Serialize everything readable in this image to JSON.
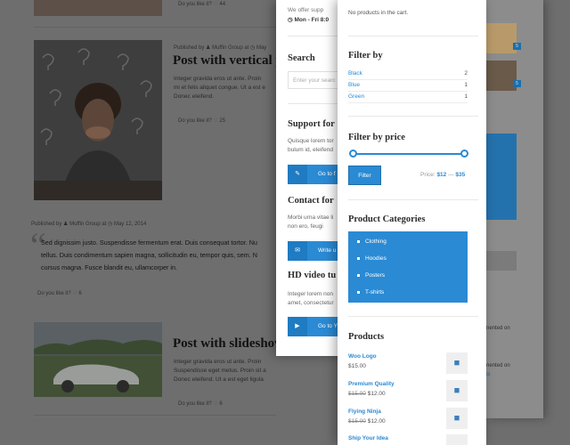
{
  "blog": {
    "post_top_like": "Do you like it?",
    "post_top_like_count": "44",
    "post1": {
      "published_by": "Published by",
      "author": "Muffin Group",
      "at": "at",
      "date": "May",
      "title": "Post with vertical p",
      "excerpt_lines": [
        "Integer gravida eros ut ante. Proin",
        "mi et felis aliquet congue. Ut a est e",
        "Donec eleifend."
      ],
      "like": "Do you like it?",
      "like_count": "25"
    },
    "quote": {
      "published_by": "Published by",
      "author": "Muffin Group",
      "at": "at",
      "date": "May 12, 2014",
      "lines": [
        "Sed dignissim justo. Suspendisse fermentum erat. Duis consequat tortor. Nu",
        "tellus. Duis condimentum sapien magna, sollicitudin eu, tempor quis, sem. N",
        "cursus magna. Fusce blandit eu, ullamcorper in."
      ],
      "like": "Do you like it?",
      "like_count": "6"
    },
    "post2": {
      "title": "Post with slideshow",
      "excerpt_lines": [
        "Integer gravida eros ut ante. Proin",
        "Suspendisse eget metus. Proin sit a",
        "Donec eleifend. Ut a est eget ligula"
      ],
      "like": "Do you like it?",
      "like_count": "6"
    },
    "right_badges": [
      "5",
      "5"
    ],
    "right_texts": [
      "nented on",
      "nented on",
      "is"
    ]
  },
  "widgets_mid": {
    "offer_text": "We offer supp",
    "hours": "Mon - Fri 8:0",
    "search": {
      "heading": "Search",
      "placeholder": "Enter your searc"
    },
    "support": {
      "heading": "Support for",
      "text_lines": [
        "Quisque lorem tor",
        "bulum id, eleifend"
      ],
      "button": "Go to f"
    },
    "contact": {
      "heading": "Contact for",
      "text_lines": [
        "Morbi urna vitae li",
        "non ero, feugi"
      ],
      "button": "Write u"
    },
    "video": {
      "heading": "HD video tu",
      "text_lines": [
        "Integer lorem non",
        "amet, consectetur"
      ],
      "button": "Go to Y"
    }
  },
  "widgets_front": {
    "cart_text": "No products in the cart.",
    "filter_by": {
      "heading": "Filter by",
      "items": [
        {
          "name": "Black",
          "count": "2"
        },
        {
          "name": "Blue",
          "count": "1"
        },
        {
          "name": "Green",
          "count": "1"
        }
      ]
    },
    "filter_by_price": {
      "heading": "Filter by price",
      "button": "Filter",
      "price_label": "Price:",
      "min": "$12",
      "dash": "—",
      "max": "$35",
      "range_min_fraction": 0,
      "range_max_fraction": 1
    },
    "categories": {
      "heading": "Product Categories",
      "items": [
        "Clothing",
        "Hoodies",
        "Posters",
        "T-shirts"
      ]
    },
    "products": {
      "heading": "Products",
      "items": [
        {
          "name": "Woo Logo",
          "old_price": "",
          "price": "$15.00"
        },
        {
          "name": "Premium Quality",
          "old_price": "$15.00",
          "price": "$12.00"
        },
        {
          "name": "Flying Ninja",
          "old_price": "$15.00",
          "price": "$12.00"
        },
        {
          "name": "Ship Your Idea",
          "old_price": "",
          "price": ""
        }
      ]
    }
  },
  "colors": {
    "accent": "#2a8ad4",
    "overlay": "#6e6e6e",
    "panel": "#ffffff"
  },
  "icons": {
    "user": "user-icon",
    "clock": "clock-icon",
    "heart": "heart-icon",
    "quote": "quote-icon"
  }
}
